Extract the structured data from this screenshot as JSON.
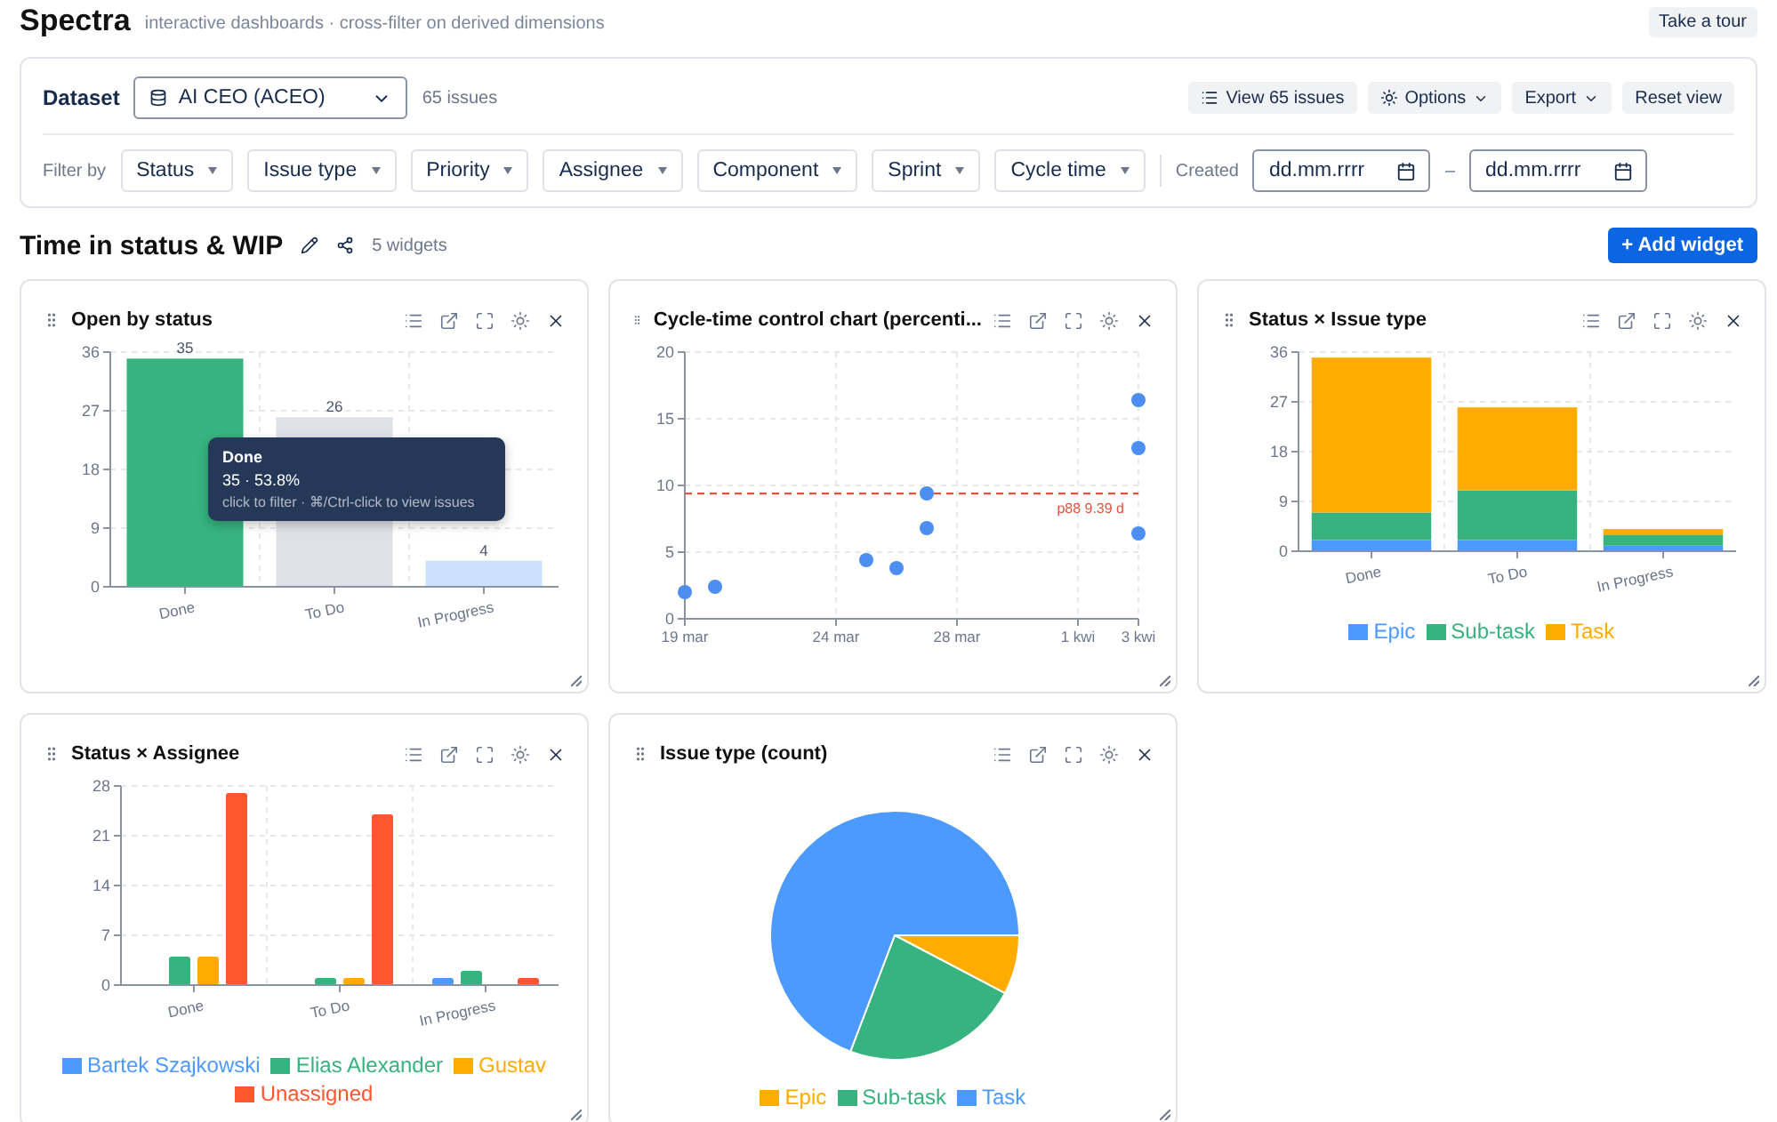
{
  "app": {
    "name": "Spectra",
    "tagline": "interactive dashboards · cross-filter on derived dimensions",
    "tour_button": "Take a tour"
  },
  "toolbar": {
    "dataset_label": "Dataset",
    "dataset": "AI CEO (ACEO)",
    "issue_count": "65 issues",
    "actions": [
      {
        "label": "View 65 issues",
        "kind": "list"
      },
      {
        "label": "Options",
        "kind": "settings"
      },
      {
        "label": "Export",
        "kind": "menu"
      },
      {
        "label": "Reset view",
        "kind": "plain"
      }
    ],
    "filter_label": "Filter by",
    "filters": [
      "Status",
      "Issue type",
      "Priority",
      "Assignee",
      "Component",
      "Sprint",
      "Cycle time"
    ],
    "created_label": "Created",
    "date_from": {
      "placeholder": "dd.mm.rrrr"
    },
    "date_separator": "–",
    "date_to": {
      "placeholder": "dd.mm.rrrr"
    }
  },
  "dashboard": {
    "title": "Time in status & WIP",
    "widget_count": "5 widgets",
    "add_button": "+ Add widget"
  },
  "widgets": [
    {
      "title": "Open by status",
      "tooltip": {
        "title": "Done",
        "value": "35 · 53.8%",
        "hint": "click to filter · ⌘/Ctrl-click to view issues"
      },
      "chart_data": {
        "type": "bar",
        "categories": [
          "Done",
          "To Do",
          "In Progress"
        ],
        "series": [
          {
            "colors": [
              "#36b37e",
              "#dfe1e6",
              "#cce0ff"
            ],
            "values": [
              35,
              26,
              4
            ]
          }
        ],
        "ylim": [
          0,
          36
        ],
        "yticks": [
          0,
          9,
          18,
          27,
          36
        ],
        "grid": true,
        "data_labels": true
      }
    },
    {
      "title": "Cycle-time control chart (percenti...",
      "chart_data": {
        "type": "scatter",
        "categories": [
          "19 mar",
          null,
          null,
          null,
          null,
          "24 mar",
          null,
          null,
          null,
          "28 mar",
          null,
          null,
          null,
          "1 kwi",
          null,
          "3 kwi"
        ],
        "series": [
          {
            "color": "#4c8ff0",
            "values": [
              2.0,
              2.4,
              null,
              null,
              null,
              null,
              4.4,
              3.8,
              9.4,
              null,
              null,
              null,
              null,
              null,
              null,
              16.4
            ]
          },
          {
            "color": "#4c8ff0",
            "values": [
              null,
              null,
              null,
              null,
              null,
              null,
              null,
              null,
              6.8,
              null,
              null,
              null,
              null,
              null,
              null,
              12.8
            ]
          },
          {
            "color": "#4c8ff0",
            "values": [
              null,
              null,
              null,
              null,
              null,
              null,
              null,
              null,
              null,
              null,
              null,
              null,
              null,
              null,
              null,
              6.4
            ]
          }
        ],
        "grid": true,
        "ylim": [
          0,
          20
        ],
        "yticks": [
          0,
          5,
          10,
          15,
          20
        ],
        "ref_lines": [
          {
            "axis": "y",
            "value": 9.39,
            "label": "p88 9.39 d"
          }
        ]
      }
    },
    {
      "title": "Status × Issue type",
      "chart_data": {
        "type": "bar",
        "stacked": true,
        "categories": [
          "Done",
          "To Do",
          "In Progress"
        ],
        "series": [
          {
            "name": "Epic",
            "color": "#4c9aff",
            "values": [
              2,
              2,
              1
            ]
          },
          {
            "name": "Sub-task",
            "color": "#36b37e",
            "values": [
              5,
              9,
              2
            ]
          },
          {
            "name": "Task",
            "color": "#ffab00",
            "values": [
              28,
              15,
              1
            ]
          }
        ],
        "ylim": [
          0,
          36
        ],
        "yticks": [
          0,
          9,
          18,
          27,
          36
        ],
        "grid": true,
        "legend": "bottom"
      }
    },
    {
      "title": "Status × Assignee",
      "chart_data": {
        "type": "bar",
        "stacked": false,
        "categories": [
          "Done",
          "To Do",
          "In Progress"
        ],
        "series": [
          {
            "name": "Bartek Szajkowski",
            "color": "#4c9aff",
            "values": [
              0,
              0,
              1
            ]
          },
          {
            "name": "Elias Alexander",
            "color": "#36b37e",
            "values": [
              4,
              1,
              2
            ]
          },
          {
            "name": "Gustav",
            "color": "#ffab00",
            "values": [
              4,
              1,
              0
            ]
          },
          {
            "name": "Unassigned",
            "color": "#ff5630",
            "values": [
              27,
              24,
              1
            ]
          }
        ],
        "ylim": [
          0,
          28
        ],
        "yticks": [
          0,
          7,
          14,
          21,
          28
        ],
        "grid": true,
        "legend": "bottom"
      }
    },
    {
      "title": "Issue type (count)",
      "chart_data": {
        "type": "pie",
        "categories": [
          "Epic",
          "Sub-task",
          "Task"
        ],
        "series": [
          {
            "colors": [
              "#ffab00",
              "#36b37e",
              "#4c9aff"
            ],
            "values": [
              7.7,
              23.1,
              69.2
            ]
          }
        ],
        "legend": "bottom"
      }
    }
  ]
}
